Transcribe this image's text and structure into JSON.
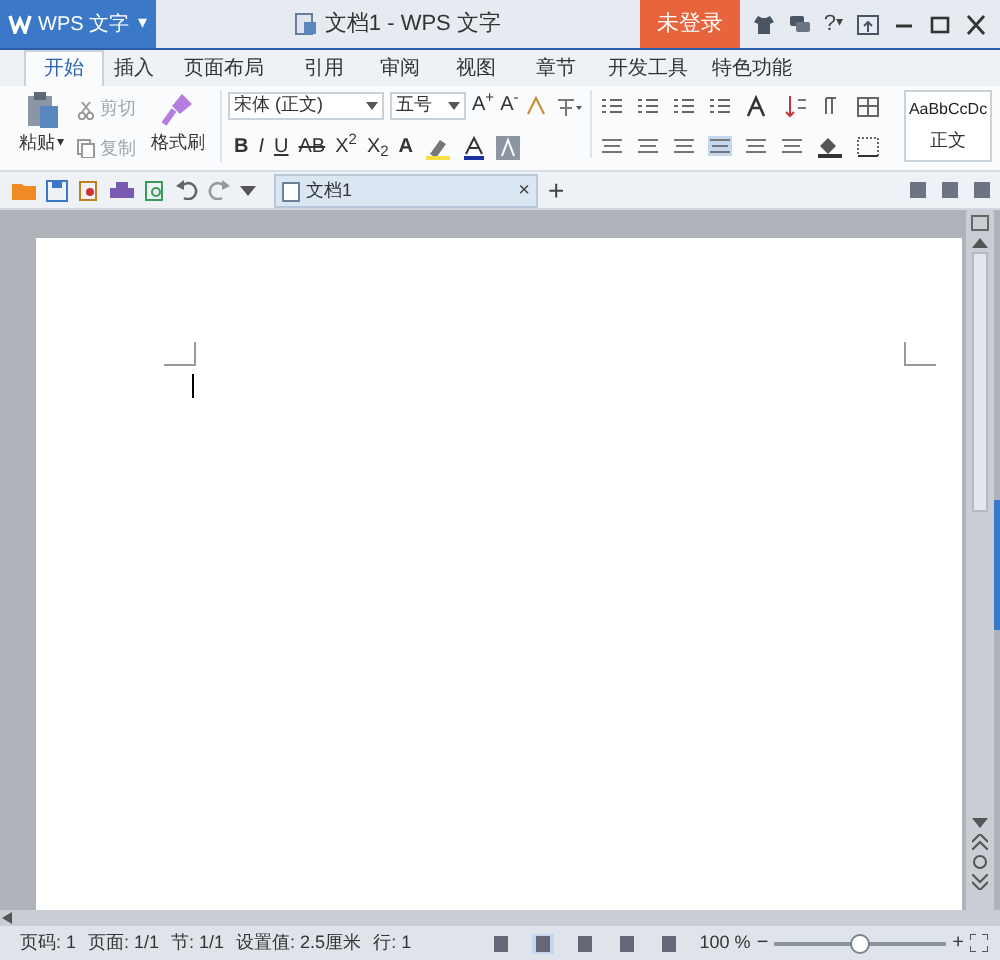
{
  "app_menu": {
    "label": "WPS 文字",
    "caret": "▾"
  },
  "window": {
    "title": "文档1 - WPS 文字"
  },
  "login_button": {
    "label": "未登录"
  },
  "help_button": {
    "label": "?",
    "caret": "▾"
  },
  "tabs": [
    {
      "label": "开始",
      "selected": true
    },
    {
      "label": "插入",
      "selected": false
    },
    {
      "label": "页面布局",
      "selected": false
    },
    {
      "label": "引用",
      "selected": false
    },
    {
      "label": "审阅",
      "selected": false
    },
    {
      "label": "视图",
      "selected": false
    },
    {
      "label": "章节",
      "selected": false
    },
    {
      "label": "开发工具",
      "selected": false
    },
    {
      "label": "特色功能",
      "selected": false
    }
  ],
  "clipboard": {
    "paste": "粘贴",
    "paste_caret": "▾",
    "cut": "剪切",
    "copy": "复制",
    "format_painter": "格式刷",
    "cut_disabled": true
  },
  "font": {
    "name": "宋体 (正文)",
    "size": "五号"
  },
  "format_buttons": [
    "B",
    "I",
    "U",
    "AB",
    "X$^{2}$",
    "X$_{2}$",
    "A"
  ],
  "grow_buttons": [
    "A$^{+}$",
    "A$^{-}$"
  ],
  "style_gallery": {
    "preview": "AaBbCcDc",
    "name": "正文"
  },
  "document_tab": {
    "label": "文档1",
    "close": "×"
  },
  "new_tab_button": "+",
  "status_bar": {
    "fields": [
      "页码: 1",
      "页面: 1/1",
      "节: 1/1",
      "设置值: 2.5厘米",
      "行: 1"
    ],
    "zoom": "100 %",
    "zoom_out": "−",
    "zoom_in": "+",
    "zoom_slider": {
      "level": 0.5
    }
  }
}
